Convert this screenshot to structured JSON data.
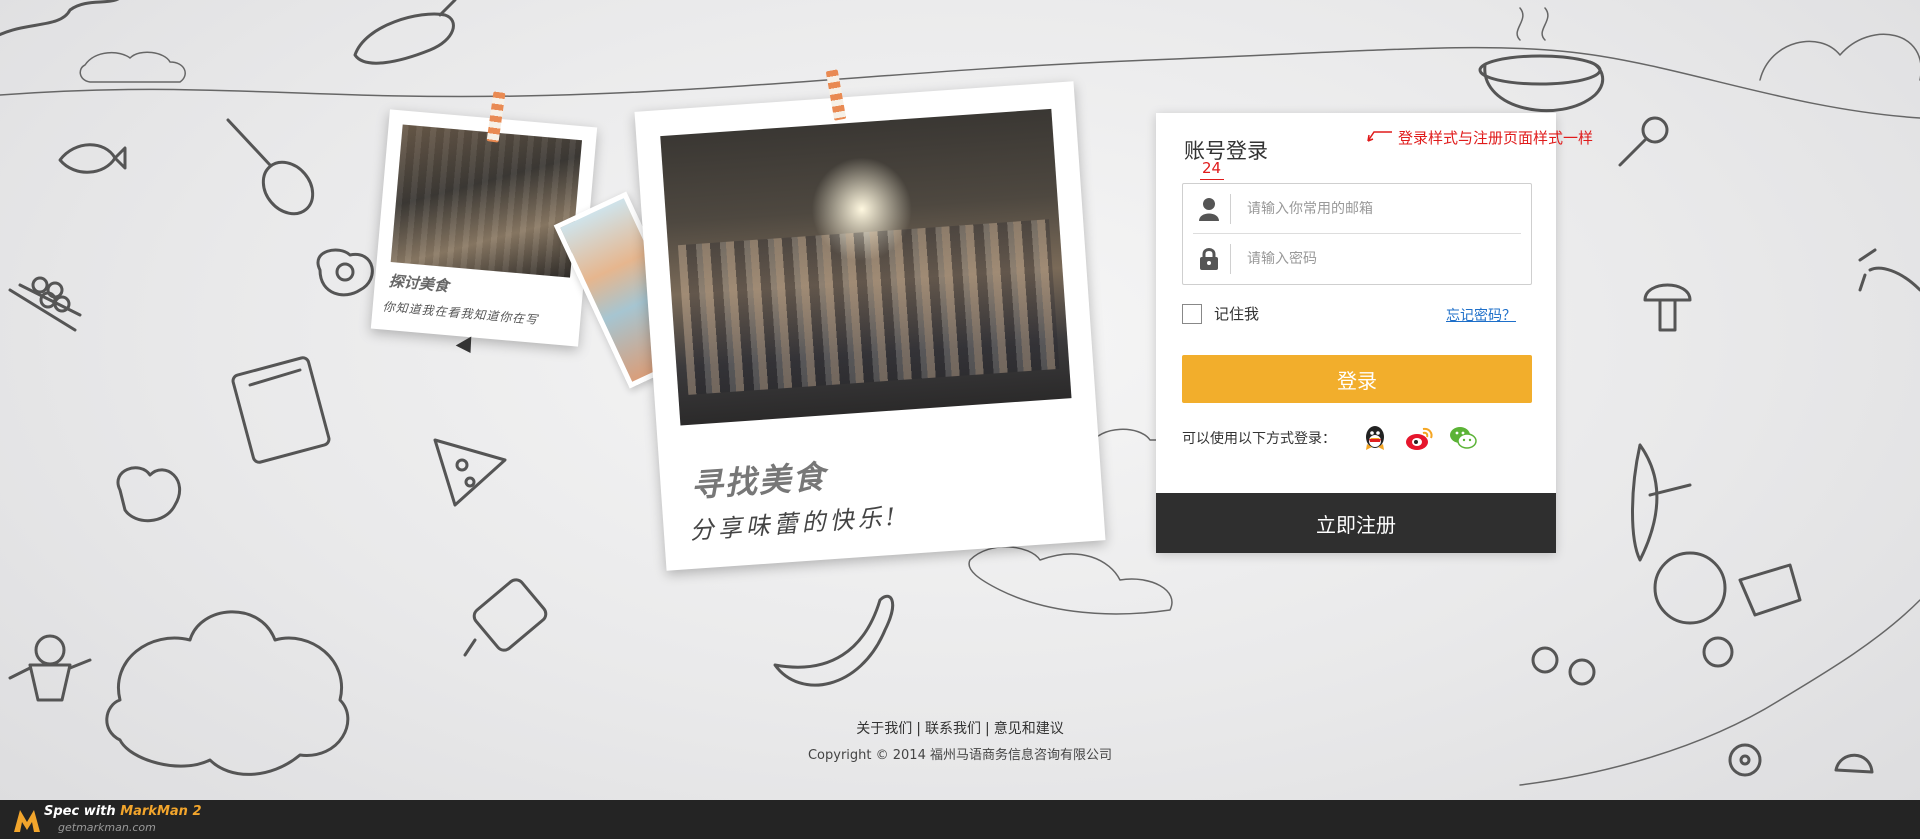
{
  "login": {
    "title": "账号登录",
    "annotation_number": "24",
    "annotation_note": "登录样式与注册页面样式一样",
    "email_placeholder": "请输入你常用的邮箱",
    "password_placeholder": "请输入密码",
    "remember_label": "记住我",
    "forgot_label": "忘记密码？",
    "login_button": "登录",
    "social_label": "可以使用以下方式登录：",
    "social_providers": [
      "qq-icon",
      "weibo-icon",
      "wechat-icon"
    ],
    "register_button": "立即注册"
  },
  "polaroids": {
    "small_title": "探讨美食",
    "small_caption": "你知道我在看我知道你在写",
    "big_title": "寻找美食",
    "big_caption": "分享味蕾的快乐!"
  },
  "footer": {
    "links": [
      "关于我们",
      "联系我们",
      "意见和建议"
    ],
    "separator": "|",
    "copyright": "Copyright © 2014 福州马语商务信息咨询有限公司"
  },
  "markman": {
    "prefix": "Spec with ",
    "brand": "MarkMan 2",
    "url": "getmarkman.com"
  },
  "colors": {
    "accent": "#f2ae2c",
    "register_bg": "#2f2f2f",
    "link": "#1e6fc9",
    "annotation": "#e01b1b"
  }
}
